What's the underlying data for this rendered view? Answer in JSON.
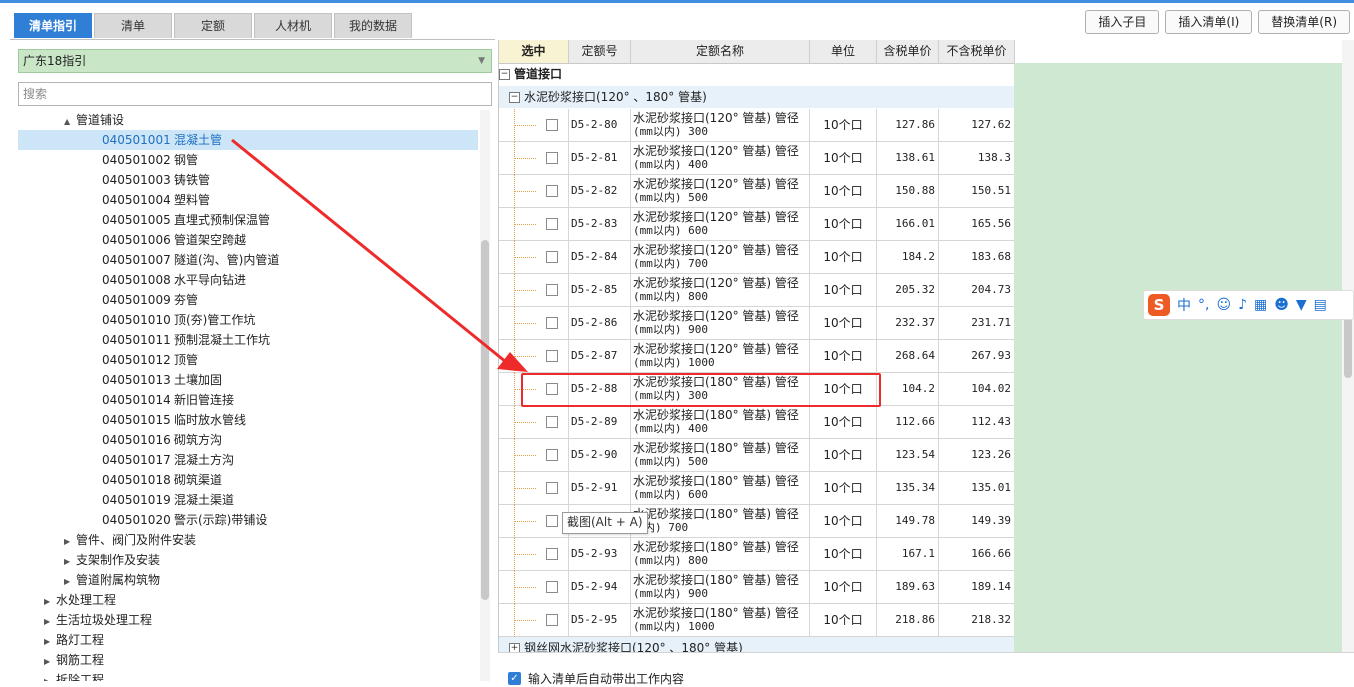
{
  "tabs": [
    {
      "label": "清单指引",
      "active": true
    },
    {
      "label": "清单",
      "active": false
    },
    {
      "label": "定额",
      "active": false
    },
    {
      "label": "人材机",
      "active": false
    },
    {
      "label": "我的数据",
      "active": false
    }
  ],
  "toolbar": {
    "insert_sub": "插入子目",
    "insert_list": "插入清单(I)",
    "replace_list": "替换清单(R)"
  },
  "library": {
    "selected": "广东18指引"
  },
  "search": {
    "placeholder": "搜索"
  },
  "tree": [
    {
      "indent": 2,
      "arrow": "▲",
      "code": "",
      "name": "管道铺设",
      "selected": false
    },
    {
      "indent": 4,
      "arrow": "",
      "code": "040501001",
      "name": "混凝土管",
      "selected": true
    },
    {
      "indent": 4,
      "arrow": "",
      "code": "040501002",
      "name": "钢管",
      "selected": false
    },
    {
      "indent": 4,
      "arrow": "",
      "code": "040501003",
      "name": "铸铁管",
      "selected": false
    },
    {
      "indent": 4,
      "arrow": "",
      "code": "040501004",
      "name": "塑料管",
      "selected": false
    },
    {
      "indent": 4,
      "arrow": "",
      "code": "040501005",
      "name": "直埋式预制保温管",
      "selected": false
    },
    {
      "indent": 4,
      "arrow": "",
      "code": "040501006",
      "name": "管道架空跨越",
      "selected": false
    },
    {
      "indent": 4,
      "arrow": "",
      "code": "040501007",
      "name": "隧道(沟、管)内管道",
      "selected": false
    },
    {
      "indent": 4,
      "arrow": "",
      "code": "040501008",
      "name": "水平导向钻进",
      "selected": false
    },
    {
      "indent": 4,
      "arrow": "",
      "code": "040501009",
      "name": "夯管",
      "selected": false
    },
    {
      "indent": 4,
      "arrow": "",
      "code": "040501010",
      "name": "顶(夯)管工作坑",
      "selected": false
    },
    {
      "indent": 4,
      "arrow": "",
      "code": "040501011",
      "name": "预制混凝土工作坑",
      "selected": false
    },
    {
      "indent": 4,
      "arrow": "",
      "code": "040501012",
      "name": "顶管",
      "selected": false
    },
    {
      "indent": 4,
      "arrow": "",
      "code": "040501013",
      "name": "土壤加固",
      "selected": false
    },
    {
      "indent": 4,
      "arrow": "",
      "code": "040501014",
      "name": "新旧管连接",
      "selected": false
    },
    {
      "indent": 4,
      "arrow": "",
      "code": "040501015",
      "name": "临时放水管线",
      "selected": false
    },
    {
      "indent": 4,
      "arrow": "",
      "code": "040501016",
      "name": "砌筑方沟",
      "selected": false
    },
    {
      "indent": 4,
      "arrow": "",
      "code": "040501017",
      "name": "混凝土方沟",
      "selected": false
    },
    {
      "indent": 4,
      "arrow": "",
      "code": "040501018",
      "name": "砌筑渠道",
      "selected": false
    },
    {
      "indent": 4,
      "arrow": "",
      "code": "040501019",
      "name": "混凝土渠道",
      "selected": false
    },
    {
      "indent": 4,
      "arrow": "",
      "code": "040501020",
      "name": "警示(示踪)带铺设",
      "selected": false
    },
    {
      "indent": 2,
      "arrow": "▶",
      "code": "",
      "name": "管件、阀门及附件安装",
      "selected": false
    },
    {
      "indent": 2,
      "arrow": "▶",
      "code": "",
      "name": "支架制作及安装",
      "selected": false
    },
    {
      "indent": 2,
      "arrow": "▶",
      "code": "",
      "name": "管道附属构筑物",
      "selected": false
    },
    {
      "indent": 1,
      "arrow": "▶",
      "code": "",
      "name": "水处理工程",
      "selected": false
    },
    {
      "indent": 1,
      "arrow": "▶",
      "code": "",
      "name": "生活垃圾处理工程",
      "selected": false
    },
    {
      "indent": 1,
      "arrow": "▶",
      "code": "",
      "name": "路灯工程",
      "selected": false
    },
    {
      "indent": 1,
      "arrow": "▶",
      "code": "",
      "name": "钢筋工程",
      "selected": false
    },
    {
      "indent": 1,
      "arrow": "▶",
      "code": "",
      "name": "拆除工程",
      "selected": false
    }
  ],
  "table": {
    "headers": [
      "选中",
      "定额号",
      "定额名称",
      "单位",
      "含税单价",
      "不含税单价"
    ],
    "group": "管道接口",
    "subgroup": "水泥砂浆接口(120° 、180° 管基)",
    "rows": [
      {
        "code": "D5-2-80",
        "name1": "水泥砂浆接口(120° 管基) 管径",
        "name2": "(mm以内) 300",
        "unit": "10个口",
        "tax": "127.86",
        "notax": "127.62"
      },
      {
        "code": "D5-2-81",
        "name1": "水泥砂浆接口(120° 管基) 管径",
        "name2": "(mm以内) 400",
        "unit": "10个口",
        "tax": "138.61",
        "notax": "138.3"
      },
      {
        "code": "D5-2-82",
        "name1": "水泥砂浆接口(120° 管基) 管径",
        "name2": "(mm以内) 500",
        "unit": "10个口",
        "tax": "150.88",
        "notax": "150.51"
      },
      {
        "code": "D5-2-83",
        "name1": "水泥砂浆接口(120° 管基) 管径",
        "name2": "(mm以内) 600",
        "unit": "10个口",
        "tax": "166.01",
        "notax": "165.56"
      },
      {
        "code": "D5-2-84",
        "name1": "水泥砂浆接口(120° 管基) 管径",
        "name2": "(mm以内) 700",
        "unit": "10个口",
        "tax": "184.2",
        "notax": "183.68"
      },
      {
        "code": "D5-2-85",
        "name1": "水泥砂浆接口(120° 管基) 管径",
        "name2": "(mm以内) 800",
        "unit": "10个口",
        "tax": "205.32",
        "notax": "204.73"
      },
      {
        "code": "D5-2-86",
        "name1": "水泥砂浆接口(120° 管基) 管径",
        "name2": "(mm以内) 900",
        "unit": "10个口",
        "tax": "232.37",
        "notax": "231.71"
      },
      {
        "code": "D5-2-87",
        "name1": "水泥砂浆接口(120° 管基) 管径",
        "name2": "(mm以内) 1000",
        "unit": "10个口",
        "tax": "268.64",
        "notax": "267.93"
      },
      {
        "code": "D5-2-88",
        "name1": "水泥砂浆接口(180° 管基) 管径",
        "name2": "(mm以内) 300",
        "unit": "10个口",
        "tax": "104.2",
        "notax": "104.02"
      },
      {
        "code": "D5-2-89",
        "name1": "水泥砂浆接口(180° 管基) 管径",
        "name2": "(mm以内) 400",
        "unit": "10个口",
        "tax": "112.66",
        "notax": "112.43"
      },
      {
        "code": "D5-2-90",
        "name1": "水泥砂浆接口(180° 管基) 管径",
        "name2": "(mm以内) 500",
        "unit": "10个口",
        "tax": "123.54",
        "notax": "123.26"
      },
      {
        "code": "D5-2-91",
        "name1": "水泥砂浆接口(180° 管基) 管径",
        "name2": "(mm以内) 600",
        "unit": "10个口",
        "tax": "135.34",
        "notax": "135.01"
      },
      {
        "code": "",
        "name1": "水泥砂浆接口(180° 管基) 管径",
        "name2": "以内) 700",
        "unit": "10个口",
        "tax": "149.78",
        "notax": "149.39"
      },
      {
        "code": "D5-2-93",
        "name1": "水泥砂浆接口(180° 管基) 管径",
        "name2": "(mm以内) 800",
        "unit": "10个口",
        "tax": "167.1",
        "notax": "166.66"
      },
      {
        "code": "D5-2-94",
        "name1": "水泥砂浆接口(180° 管基) 管径",
        "name2": "(mm以内) 900",
        "unit": "10个口",
        "tax": "189.63",
        "notax": "189.14"
      },
      {
        "code": "D5-2-95",
        "name1": "水泥砂浆接口(180° 管基) 管径",
        "name2": "(mm以内) 1000",
        "unit": "10个口",
        "tax": "218.86",
        "notax": "218.32"
      }
    ],
    "next_group": "钢丝网水泥砂浆接口(120° 、180° 管基)"
  },
  "tooltip": "截图(Alt + A)",
  "bottom": {
    "auto_label": "输入清单后自动带出工作内容"
  },
  "ime": {
    "logo": "S",
    "lang": "中",
    "punct": "°,"
  },
  "colors": {
    "accent": "#2f7fd6",
    "highlight": "#ee2a2a",
    "panel_green": "#cfe8d2"
  }
}
